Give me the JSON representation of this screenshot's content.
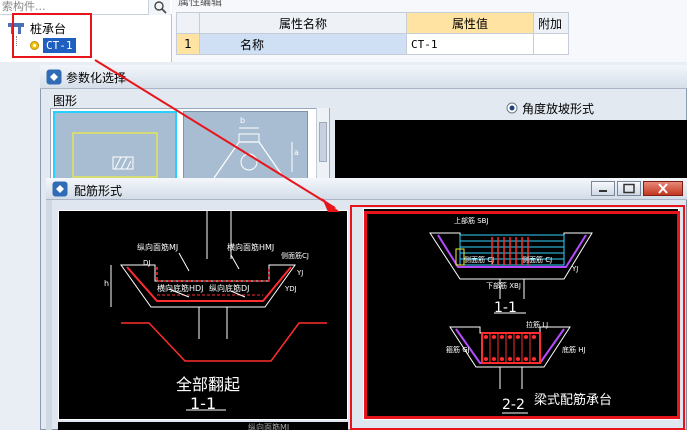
{
  "tree": {
    "search_placeholder": "索构件...",
    "root_label": "桩承台",
    "child_label": "CT-1"
  },
  "property_panel": {
    "title": "属性编辑",
    "headers": [
      "属性名称",
      "属性值",
      "附加"
    ],
    "rows": [
      {
        "num": "1",
        "name": "名称",
        "value": "CT-1",
        "extra": ""
      }
    ]
  },
  "param_dialog": {
    "title": "参数化选择",
    "group_label": "图形",
    "radio_label": "角度放坡形式",
    "thumb_labels": {
      "b": "b",
      "a": "a"
    }
  },
  "rebar_dialog": {
    "title": "配筋形式",
    "left": {
      "caption": "全部翻起",
      "section": "1-1",
      "labels": {
        "top_long": "纵向面筋MJ",
        "top_cross": "横向面筋HMJ",
        "bottom_cross": "横向底筋HDJ",
        "bottom_long": "纵向底筋DJ",
        "side": "侧面筋CJ",
        "ydj": "YDJ",
        "dj": "DJ",
        "yj": "YJ",
        "h": "h",
        "next_caption": "纵向面筋MJ"
      }
    },
    "right": {
      "caption": "梁式配筋承台",
      "section1": "1-1",
      "section2": "2-2",
      "labels": {
        "top": "上部筋 SBJ",
        "side_l": "侧面筋 CJ",
        "side_r": "侧面筋 CJ",
        "bottom": "下部筋 XBJ",
        "yj": "YJ",
        "lj": "拉筋 LJ",
        "gj": "箍筋 GJ",
        "fj": "底筋 HJ"
      }
    }
  },
  "colors": {
    "highlight": "#e8141b",
    "arrow": "#e8141b",
    "cad_bg": "#000000"
  }
}
